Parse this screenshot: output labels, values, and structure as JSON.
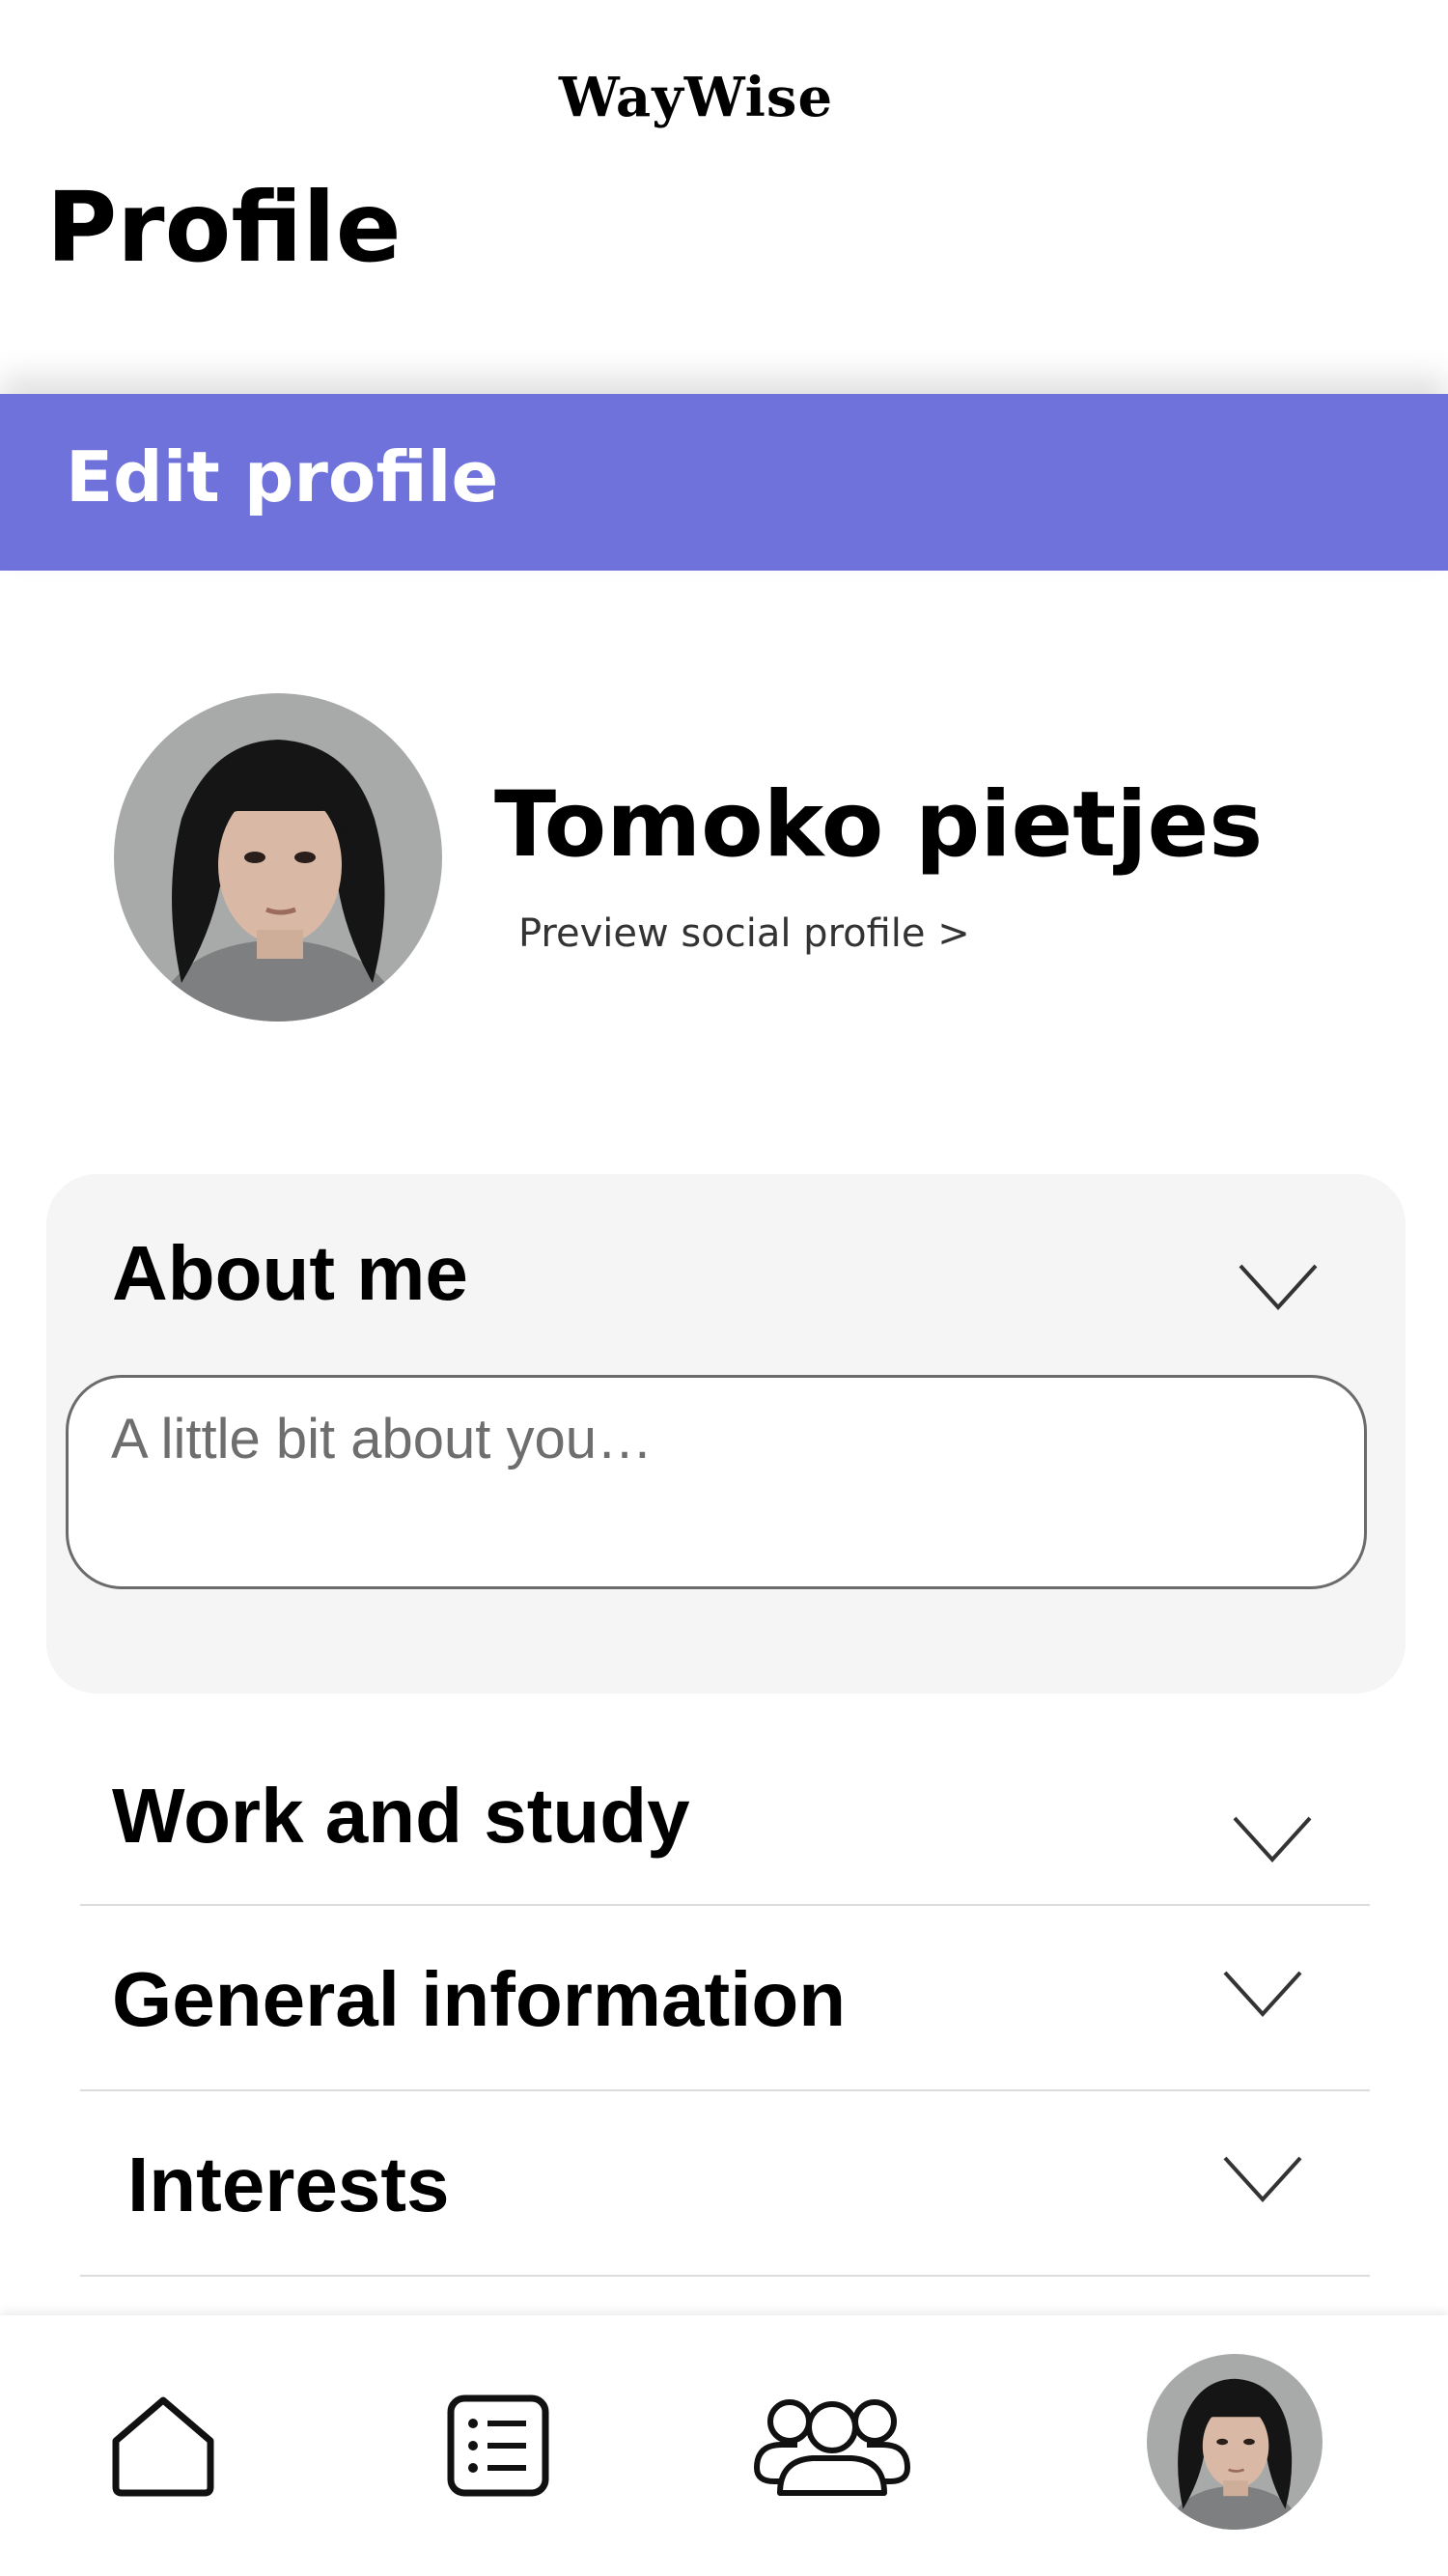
{
  "app": {
    "logo_text": "WayWise"
  },
  "header": {
    "title": "Profile"
  },
  "edit_bar": {
    "label": "Edit profile"
  },
  "user": {
    "name": "Tomoko pietjes",
    "preview_link": "Preview social profile >"
  },
  "sections": {
    "about": {
      "title": "About me",
      "placeholder": "A little bit about you…",
      "value": ""
    },
    "work": {
      "title": "Work and study"
    },
    "general": {
      "title": "General information"
    },
    "interests": {
      "title": "Interests"
    }
  },
  "icons": {
    "chevron": "chevron-down-icon",
    "tabs": [
      "home-icon",
      "list-icon",
      "community-icon",
      "profile-avatar"
    ]
  },
  "colors": {
    "accent": "#6f72db",
    "card_bg": "#f5f5f5"
  }
}
